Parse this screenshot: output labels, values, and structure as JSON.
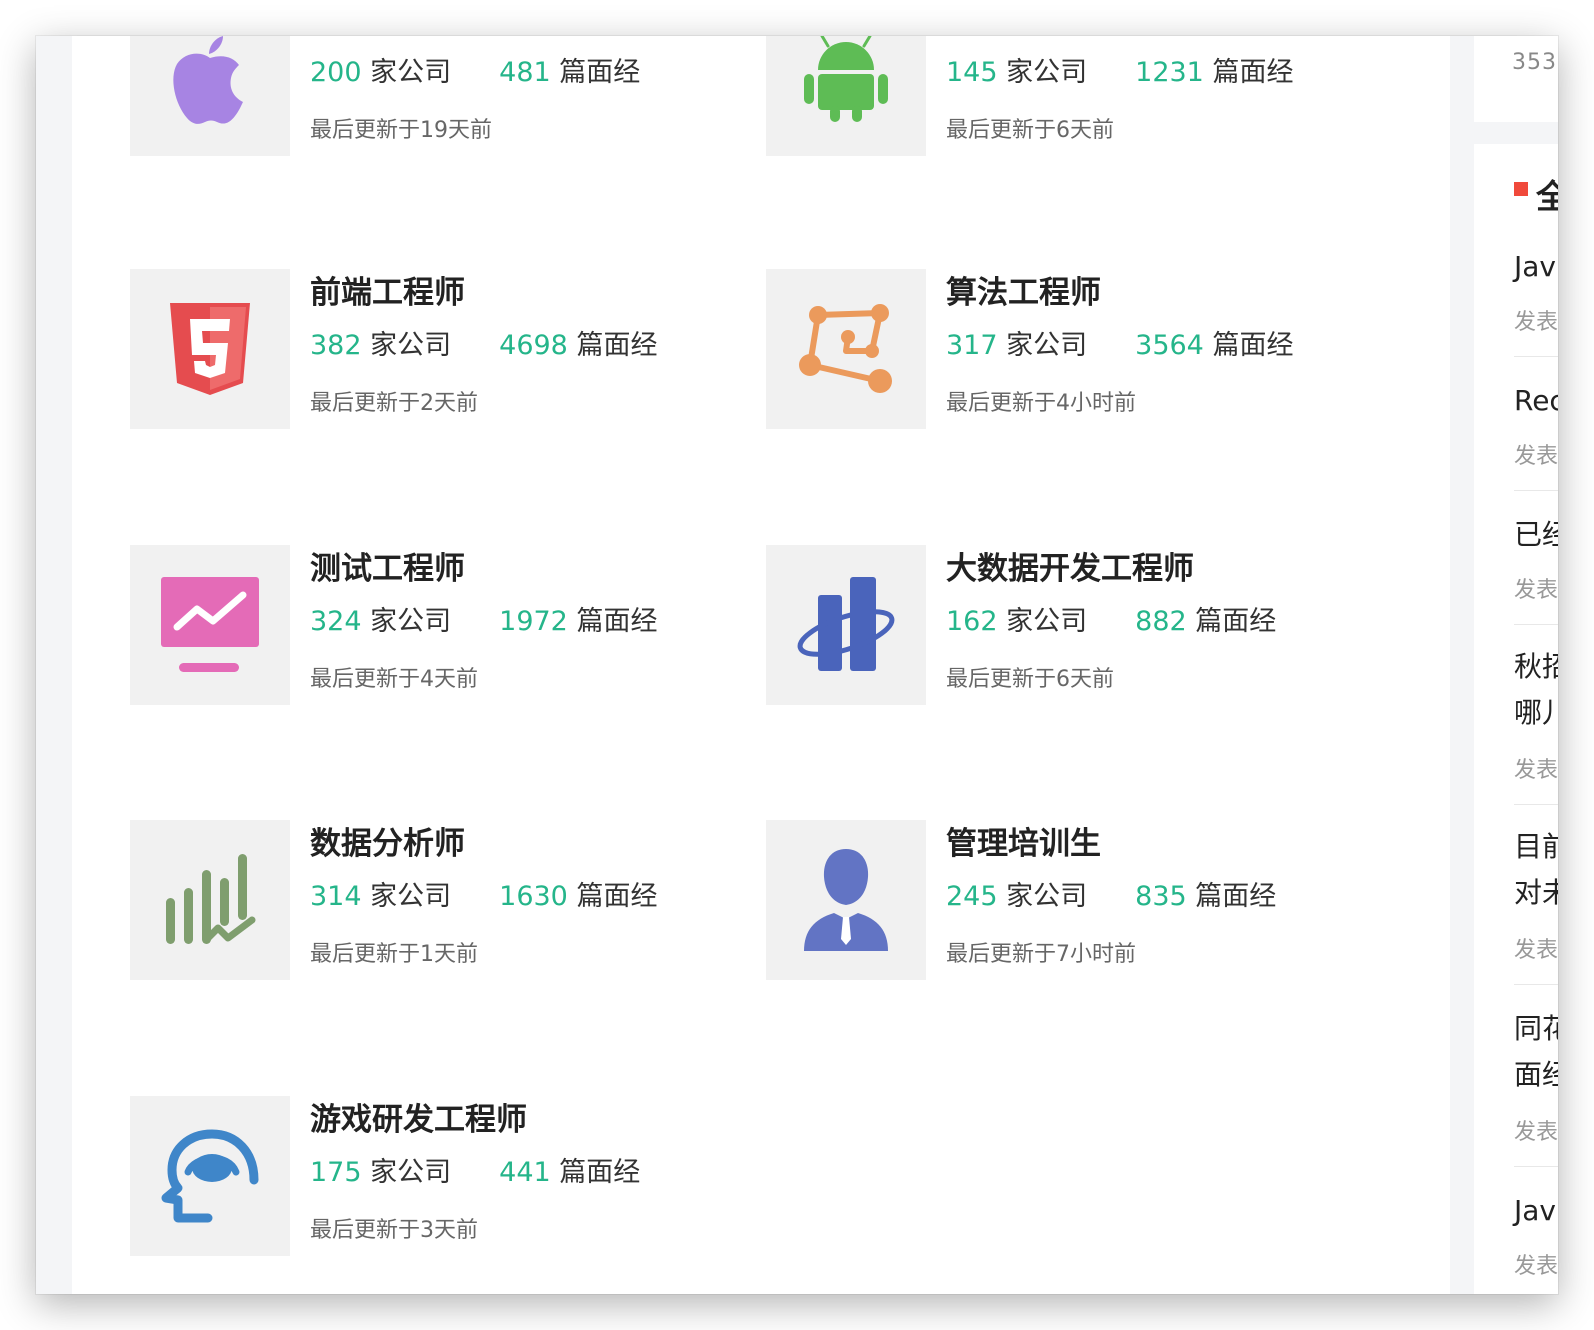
{
  "categories": [
    {
      "title": "",
      "companies": "200",
      "company_unit": "家公司",
      "posts": "481",
      "post_unit": "篇面经",
      "updated": "最后更新于19天前",
      "icon": "apple-icon"
    },
    {
      "title": "",
      "companies": "145",
      "company_unit": "家公司",
      "posts": "1231",
      "post_unit": "篇面经",
      "updated": "最后更新于6天前",
      "icon": "android-icon"
    },
    {
      "title": "前端工程师",
      "companies": "382",
      "company_unit": "家公司",
      "posts": "4698",
      "post_unit": "篇面经",
      "updated": "最后更新于2天前",
      "icon": "html5-icon"
    },
    {
      "title": "算法工程师",
      "companies": "317",
      "company_unit": "家公司",
      "posts": "3564",
      "post_unit": "篇面经",
      "updated": "最后更新于4小时前",
      "icon": "algorithm-icon"
    },
    {
      "title": "测试工程师",
      "companies": "324",
      "company_unit": "家公司",
      "posts": "1972",
      "post_unit": "篇面经",
      "updated": "最后更新于4天前",
      "icon": "monitor-chart-icon"
    },
    {
      "title": "大数据开发工程师",
      "companies": "162",
      "company_unit": "家公司",
      "posts": "882",
      "post_unit": "篇面经",
      "updated": "最后更新于6天前",
      "icon": "bigdata-icon"
    },
    {
      "title": "数据分析师",
      "companies": "314",
      "company_unit": "家公司",
      "posts": "1630",
      "post_unit": "篇面经",
      "updated": "最后更新于1天前",
      "icon": "bar-trend-icon"
    },
    {
      "title": "管理培训生",
      "companies": "245",
      "company_unit": "家公司",
      "posts": "835",
      "post_unit": "篇面经",
      "updated": "最后更新于7小时前",
      "icon": "person-tie-icon"
    },
    {
      "title": "游戏研发工程师",
      "companies": "175",
      "company_unit": "家公司",
      "posts": "441",
      "post_unit": "篇面经",
      "updated": "最后更新于3天前",
      "icon": "head-gamer-icon"
    }
  ],
  "sidebar": {
    "count_text": "353",
    "section_title": "全",
    "section_mark_color": "#f0493b",
    "articles": [
      {
        "lines": [
          "Jav"
        ],
        "meta": "发表"
      },
      {
        "lines": [
          "Rec"
        ],
        "meta": "发表"
      },
      {
        "lines": [
          "已经"
        ],
        "meta": "发表"
      },
      {
        "lines": [
          "秋招",
          "哪儿"
        ],
        "meta": "发表"
      },
      {
        "lines": [
          "目前",
          "对未"
        ],
        "meta": "发表"
      },
      {
        "lines": [
          "同花",
          "面经"
        ],
        "meta": "发表"
      },
      {
        "lines": [
          "Jav"
        ],
        "meta": "发表"
      }
    ]
  },
  "colors": {
    "accent_green": "#25b58a",
    "apple": "#a784e3",
    "android": "#5ebc55",
    "html5": "#e54c4f",
    "algorithm": "#eb9a5c",
    "monitor": "#e46bb7",
    "bigdata": "#4a64bb",
    "bar_trend": "#7f9e6e",
    "person": "#6274c4",
    "head": "#3f86c9"
  }
}
